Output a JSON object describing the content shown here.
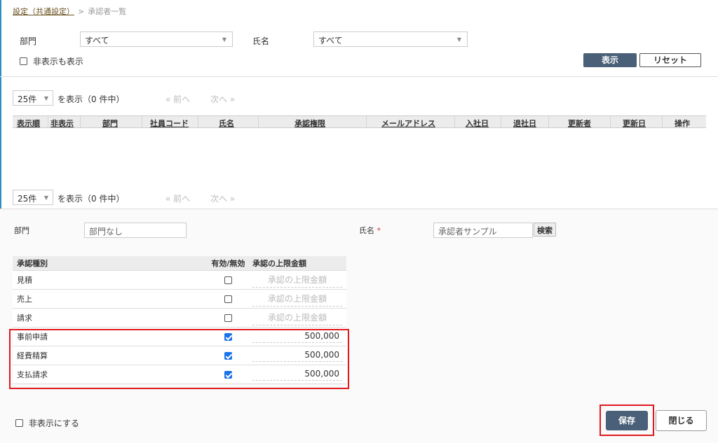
{
  "breadcrumb": {
    "parent": "設定（共通設定）",
    "separator": ">",
    "current": "承認者一覧"
  },
  "filter": {
    "dept_label": "部門",
    "dept_value": "すべて",
    "name_label": "氏名",
    "name_value": "すべて",
    "show_hidden_label": "非表示も表示",
    "display_button": "表示",
    "reset_button": "リセット"
  },
  "pager": {
    "per_page": "25件",
    "summary": "を表示（0 件中）",
    "prev": "« 前へ",
    "next": "次へ »"
  },
  "columns": [
    "表示順",
    "非表示",
    "部門",
    "社員コード",
    "氏名",
    "承認権限",
    "メールアドレス",
    "入社日",
    "退社日",
    "更新者",
    "更新日",
    "操作"
  ],
  "form": {
    "dept_label": "部門",
    "dept_value": "部門なし",
    "name_label": "氏名",
    "required_mark": "*",
    "name_value": "承認者サンプル",
    "search_button": "検索"
  },
  "approval_table": {
    "headers": [
      "承認種別",
      "有効/無効",
      "承認の上限金額"
    ],
    "placeholder": "承認の上限金額",
    "rows": [
      {
        "type": "見積",
        "enabled": false,
        "limit": ""
      },
      {
        "type": "売上",
        "enabled": false,
        "limit": ""
      },
      {
        "type": "請求",
        "enabled": false,
        "limit": ""
      },
      {
        "type": "事前申請",
        "enabled": true,
        "limit": "500,000"
      },
      {
        "type": "経費精算",
        "enabled": true,
        "limit": "500,000"
      },
      {
        "type": "支払請求",
        "enabled": true,
        "limit": "500,000"
      }
    ]
  },
  "footer": {
    "hide_label": "非表示にする",
    "save_button": "保存",
    "close_button": "閉じる"
  },
  "colors": {
    "primary_button": "#4a5f78",
    "highlight": "#e0191d",
    "checkbox_checked": "#1a73e8"
  }
}
